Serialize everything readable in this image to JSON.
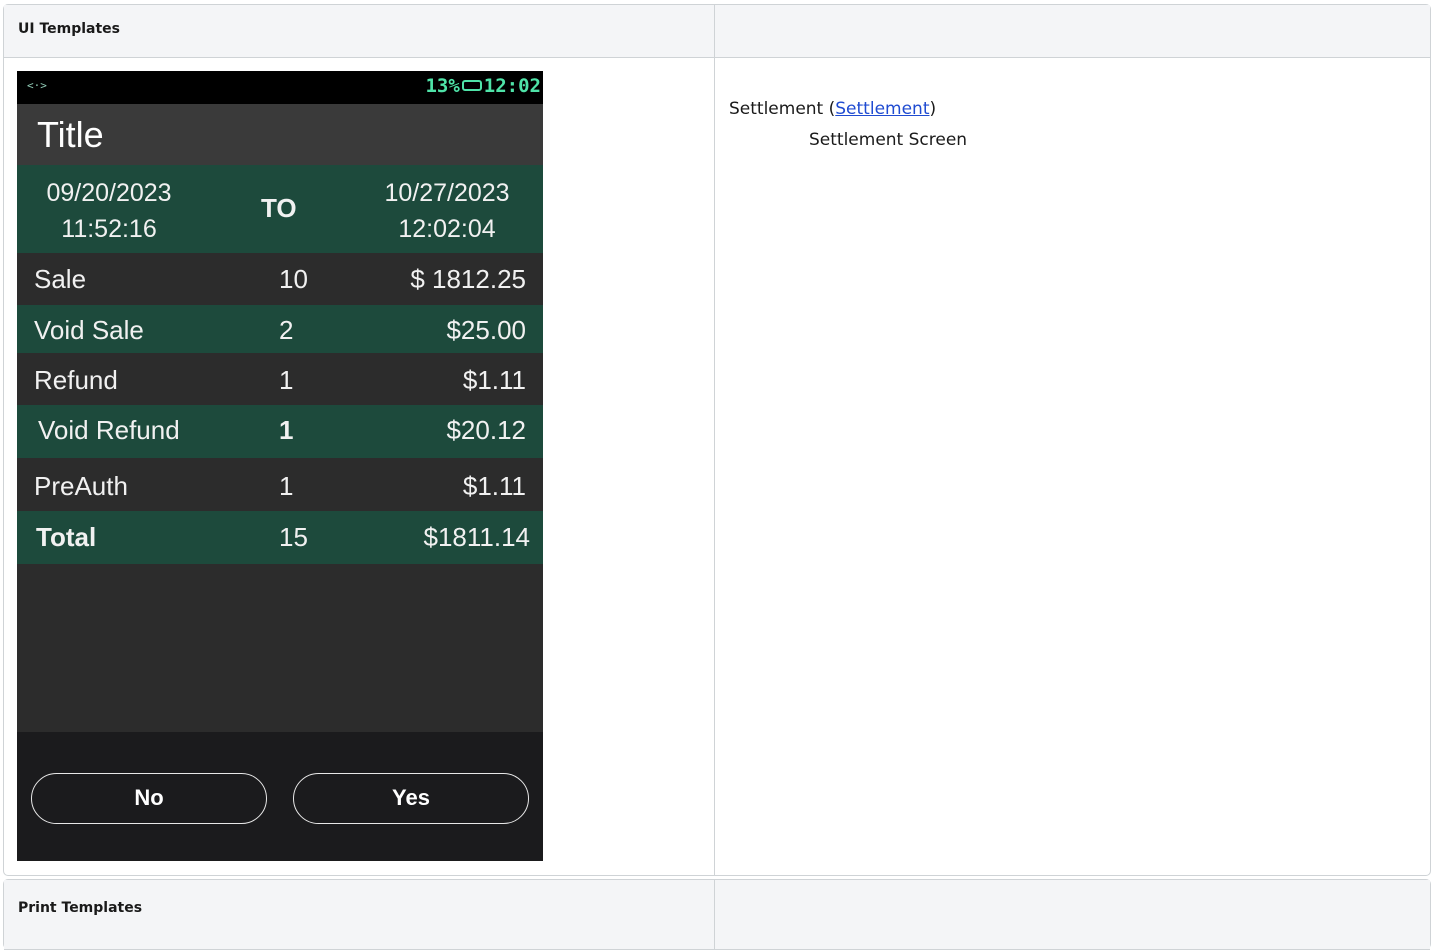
{
  "ui_section": {
    "header": "UI Templates",
    "device": {
      "status": {
        "nfc": "<·>",
        "battery_percent": "13%",
        "time": "12:02"
      },
      "title": "Title",
      "range": {
        "from_date": "09/20/2023",
        "from_time": "11:52:16",
        "to_word": "TO",
        "to_date": "10/27/2023",
        "to_time": "12:02:04"
      },
      "rows": [
        {
          "label": "Sale",
          "count": "10",
          "amount": "$ 1812.25"
        },
        {
          "label": "Void Sale",
          "count": "2",
          "amount": "$25.00"
        },
        {
          "label": "Refund",
          "count": "1",
          "amount": "$1.11"
        },
        {
          "label": "Void Refund",
          "count": "1",
          "amount": "$20.12"
        },
        {
          "label": "PreAuth",
          "count": "1",
          "amount": "$1.11"
        },
        {
          "label": "Total",
          "count": "15",
          "amount": "$1811.14"
        }
      ],
      "buttons": {
        "no": "No",
        "yes": "Yes"
      }
    },
    "description": {
      "prefix": "Settlement (",
      "link": "Settlement",
      "suffix": ")",
      "detail": "Settlement Screen"
    }
  },
  "print_section": {
    "header": "Print Templates"
  }
}
